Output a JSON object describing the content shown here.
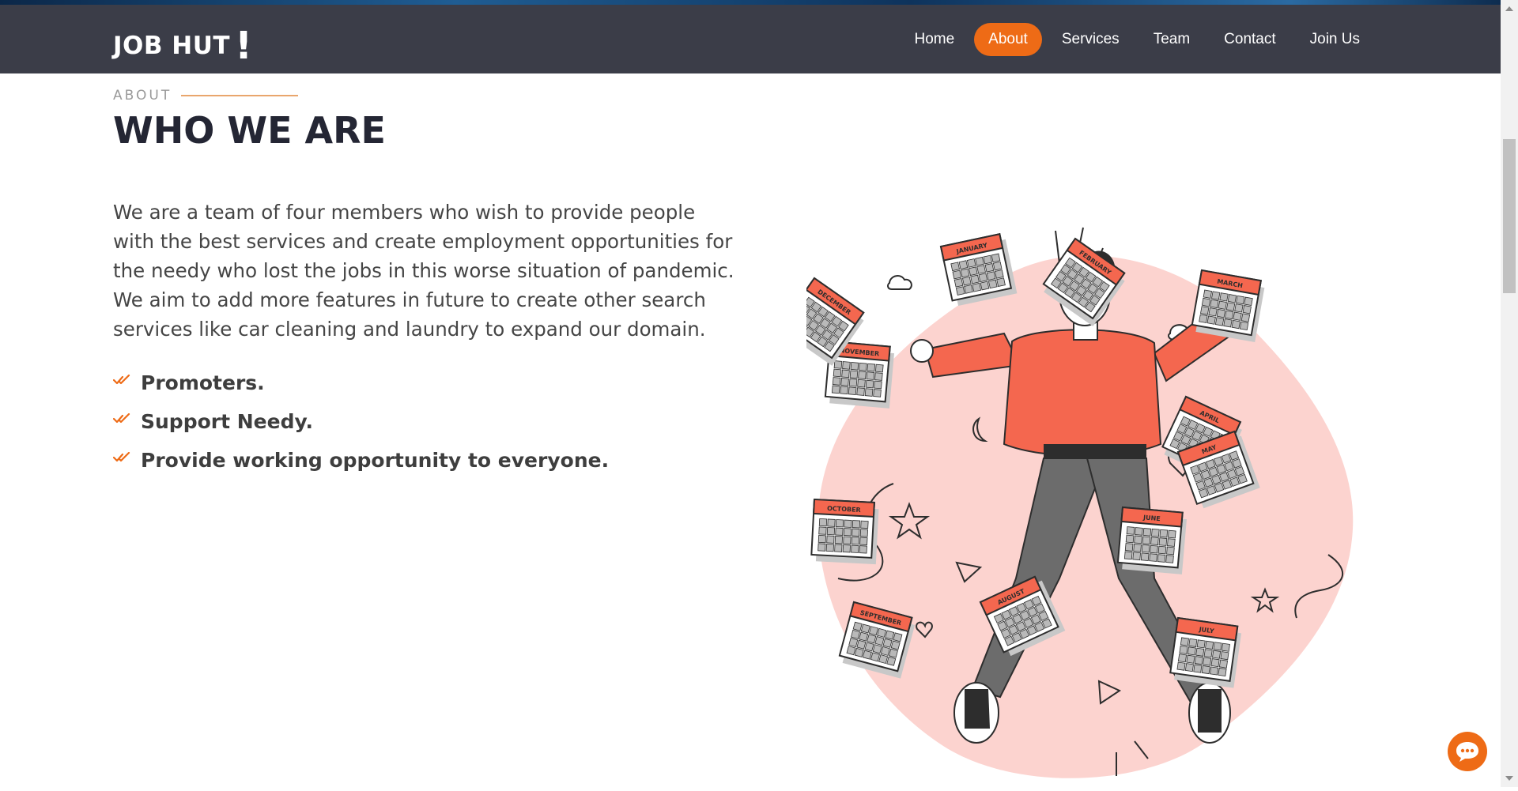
{
  "brand": {
    "name": "JOB HUT",
    "mark": "!"
  },
  "nav": {
    "items": [
      {
        "label": "Home"
      },
      {
        "label": "About"
      },
      {
        "label": "Services"
      },
      {
        "label": "Team"
      },
      {
        "label": "Contact"
      },
      {
        "label": "Join Us"
      }
    ],
    "active": "About"
  },
  "about": {
    "tag": "ABOUT",
    "title": "WHO WE ARE",
    "paragraph": "We are a team of four members who wish to provide people with the best services and create employment opportunities for the needy who lost the jobs in this worse situation of pandemic. We aim to add more features in future to create other search services like car cleaning and laundry to expand our domain.",
    "features": [
      "Promoters.",
      "Support Needy.",
      "Provide working opportunity to everyone."
    ]
  },
  "illustration": {
    "months": [
      "JANUARY",
      "FEBRUARY",
      "MARCH",
      "APRIL",
      "MAY",
      "JUNE",
      "JULY",
      "AUGUST",
      "SEPTEMBER",
      "OCTOBER",
      "NOVEMBER",
      "DECEMBER"
    ]
  },
  "colors": {
    "accent": "#ee6b16",
    "navbar": "#3b3d48",
    "heading": "#242634",
    "illustration_red": "#f4674f",
    "blob": "#fcd3cf"
  },
  "icons": {
    "feature_bullet": "double-check-icon",
    "chat": "chat-bubble-icon"
  }
}
